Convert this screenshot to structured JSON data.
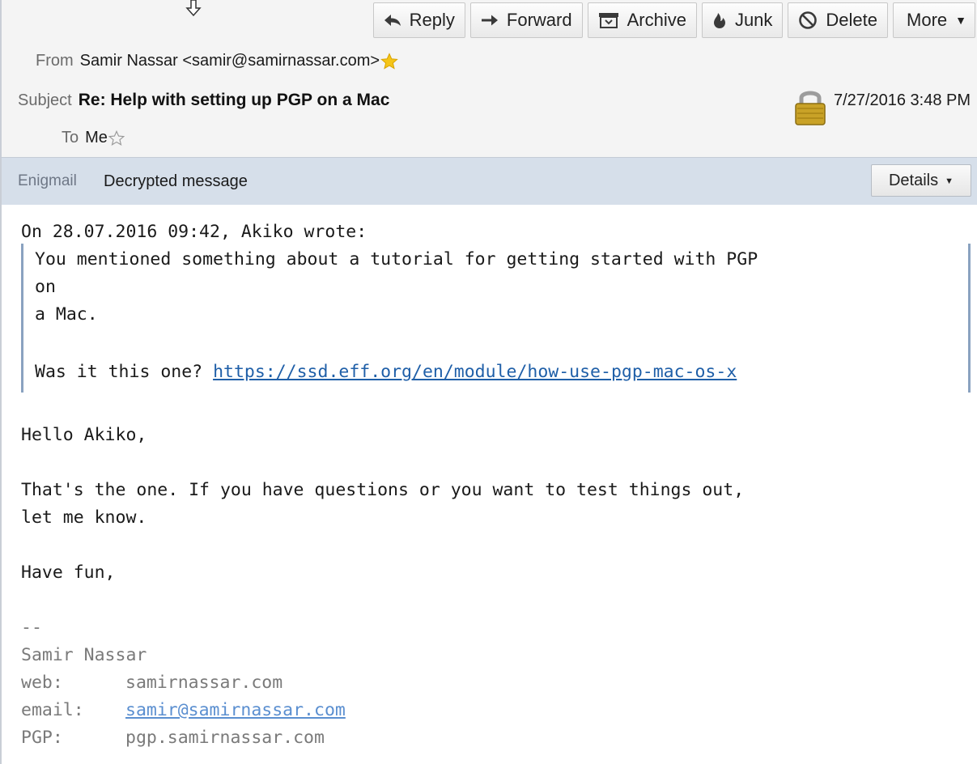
{
  "toolbar": {
    "reply": "Reply",
    "forward": "Forward",
    "archive": "Archive",
    "junk": "Junk",
    "delete": "Delete",
    "more": "More"
  },
  "header": {
    "from_label": "From",
    "from_value": "Samir Nassar <samir@samirnassar.com>",
    "subject_label": "Subject",
    "subject_value": "Re: Help with setting up PGP on a Mac",
    "to_label": "To",
    "to_value": "Me",
    "date": "7/27/2016 3:48 PM"
  },
  "enigmail": {
    "label": "Enigmail",
    "status": "Decrypted message",
    "details": "Details"
  },
  "message": {
    "attribution": "On 28.07.2016 09:42, Akiko wrote:",
    "quote": {
      "line1": "You mentioned something about a tutorial for getting started with PGP",
      "line2": "on",
      "line3": "a Mac.",
      "line4_prefix": "Was it this one? ",
      "link": "https://ssd.eff.org/en/module/how-use-pgp-mac-os-x"
    },
    "greeting": "Hello Akiko,",
    "para1_line1": "That's the one. If you have questions or you want to test things out,",
    "para1_line2": "let me know.",
    "closing": "Have fun,",
    "signature": {
      "separator": "--",
      "name": "Samir Nassar",
      "web_label": "web:",
      "web_value": "samirnassar.com",
      "email_label": "email:",
      "email_value": "samir@samirnassar.com",
      "pgp_label": "PGP:",
      "pgp_value": "pgp.samirnassar.com"
    }
  },
  "icons": {
    "reply": "reply-arrow-icon",
    "forward": "forward-arrow-icon",
    "archive": "archive-box-icon",
    "junk": "flame-icon",
    "delete": "prohibited-icon",
    "star_filled": "star-filled-icon",
    "star_empty": "star-outline-icon",
    "lock": "padlock-icon"
  },
  "colors": {
    "enigmail_bar": "#d6dfea",
    "link": "#1f5fa8",
    "star": "#f5c518",
    "lock": "#c9a227",
    "quote_border": "#8aa2c0"
  }
}
